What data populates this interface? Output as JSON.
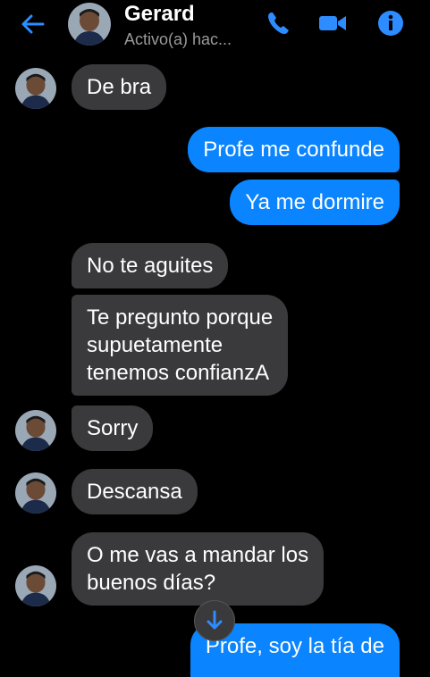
{
  "header": {
    "name": "Gerard",
    "status": "Activo(a) hac..."
  },
  "messages": [
    {
      "text": "De bra",
      "from": "them"
    },
    {
      "text": "Profe me confunde",
      "from": "me"
    },
    {
      "text": "Ya me dormire",
      "from": "me"
    },
    {
      "text": "No te aguites",
      "from": "them"
    },
    {
      "text": "Te pregunto  porque\nsupuetamente\ntenemos confianzA",
      "from": "them"
    },
    {
      "text": "Sorry",
      "from": "them"
    },
    {
      "text": "Descansa",
      "from": "them"
    },
    {
      "text": "O me vas a mandar los\nbuenos días?",
      "from": "them"
    },
    {
      "text": "Profe, soy la tía de",
      "from": "me"
    }
  ],
  "colors": {
    "accent": "#0a84ff",
    "incoming_bubble": "#3a3a3c",
    "background": "#000000"
  },
  "icons": [
    "back-arrow-icon",
    "phone-icon",
    "video-icon",
    "info-icon",
    "arrow-down-icon"
  ]
}
